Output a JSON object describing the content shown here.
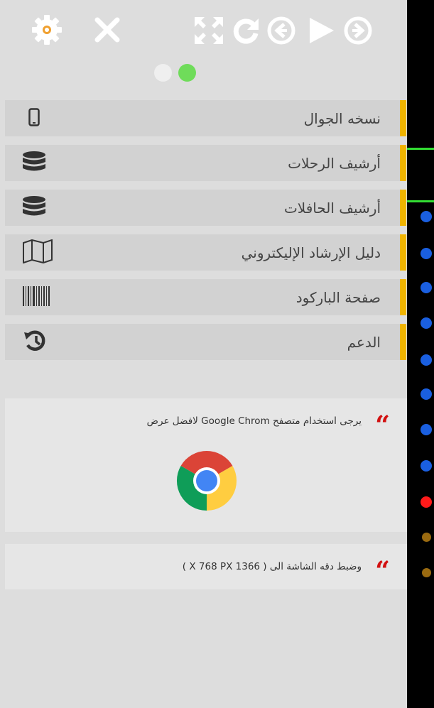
{
  "toolbar": {
    "icons": [
      "gear-icon",
      "close-icon",
      "fullscreen-icon",
      "refresh-icon",
      "back-icon",
      "play-icon",
      "forward-icon"
    ]
  },
  "pager": {
    "active_index": 1,
    "count": 2
  },
  "menu": {
    "items": [
      {
        "label": "نسخه الجوال",
        "icon": "mobile-icon"
      },
      {
        "label": "أرشيف الرحلات",
        "icon": "database-icon"
      },
      {
        "label": "أرشيف الحافلات",
        "icon": "database-icon"
      },
      {
        "label": "دليل الإرشاد الإليكتروني",
        "icon": "map-icon"
      },
      {
        "label": "صفحة الباركود",
        "icon": "barcode-icon"
      },
      {
        "label": "الدعم",
        "icon": "history-icon"
      }
    ]
  },
  "notices": {
    "browser": "يرجى استخدام متصفح Google Chrom لافضل عرض",
    "resolution": "وضبط دقه الشاشة الى ( 1366 X 768 PX )"
  },
  "colors": {
    "accent_bar": "#f0b400",
    "dot_active": "#6fdc5a",
    "dot_inactive": "#efefef",
    "quote_red": "#d21010",
    "status_blue": "#1a5fe0",
    "status_red": "#ff1a1a",
    "status_brown": "#9a6a10"
  }
}
